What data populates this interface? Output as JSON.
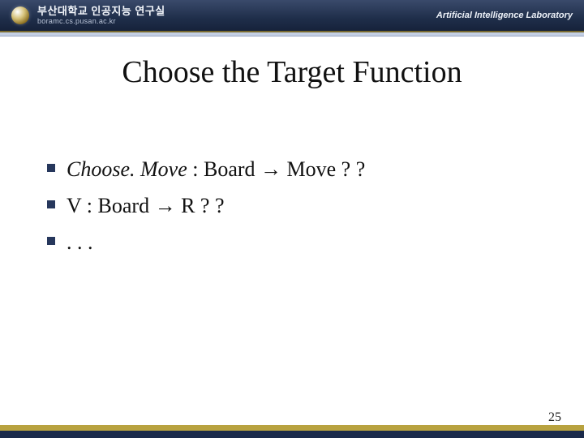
{
  "header": {
    "org_native": "부산대학교 인공지능 연구실",
    "url": "boramc.cs.pusan.ac.kr",
    "org_en": "Artificial Intelligence Laboratory"
  },
  "title": "Choose the Target Function",
  "bullets": [
    {
      "prefix_italic": "Choose. Move",
      "rest": " : Board → Move ? ?"
    },
    {
      "prefix_italic": "",
      "rest": "V : Board → R ? ?"
    },
    {
      "prefix_italic": "",
      "rest": ". . ."
    }
  ],
  "page_number": "25"
}
